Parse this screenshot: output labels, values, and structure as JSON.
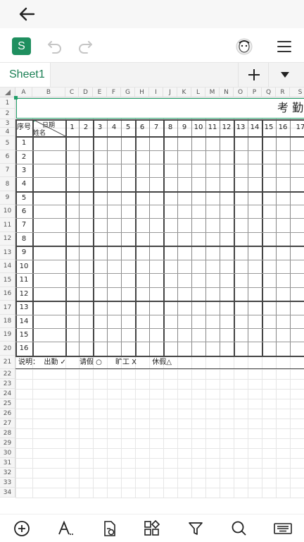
{
  "sheet": {
    "tab_label": "Sheet1",
    "logo_letter": "S",
    "title_cell": "考 勤",
    "corner_top": "日期",
    "corner_bottom": "姓名",
    "seq_header": "序号",
    "columns": [
      "A",
      "B",
      "C",
      "D",
      "E",
      "F",
      "G",
      "H",
      "I",
      "J",
      "K",
      "L",
      "M",
      "N",
      "O",
      "P",
      "Q",
      "R",
      "S"
    ],
    "day_headers": [
      "1",
      "2",
      "3",
      "4",
      "5",
      "6",
      "7",
      "8",
      "9",
      "10",
      "11",
      "12",
      "13",
      "14",
      "15",
      "16",
      "17"
    ],
    "row_numbers": [
      "1",
      "2",
      "3",
      "4",
      "5",
      "6",
      "7",
      "8",
      "9",
      "10",
      "11",
      "12",
      "13",
      "14",
      "15",
      "16",
      "17",
      "18",
      "19",
      "20",
      "21",
      "22",
      "23",
      "24",
      "25",
      "26",
      "27",
      "28",
      "29",
      "30",
      "31",
      "32",
      "33",
      "34"
    ],
    "seq_values": [
      "1",
      "2",
      "3",
      "4",
      "5",
      "6",
      "7",
      "8",
      "9",
      "10",
      "11",
      "12",
      "13",
      "14",
      "15",
      "16"
    ],
    "legend": "说明：  出勤 ✓      请假 ○      旷工 X       休假△"
  },
  "icons": {
    "back": "back-arrow-icon",
    "undo": "undo-icon",
    "redo": "redo-icon",
    "avatar": "avatar-icon",
    "menu": "menu-icon",
    "add_sheet": "plus-icon",
    "sheet_menu": "chevron-down-icon",
    "insert": "plus-circle-icon",
    "text_format": "text-format-icon",
    "cell_style": "cell-format-icon",
    "apps": "apps-icon",
    "filter": "filter-icon",
    "search": "search-icon",
    "keyboard": "keyboard-icon"
  }
}
